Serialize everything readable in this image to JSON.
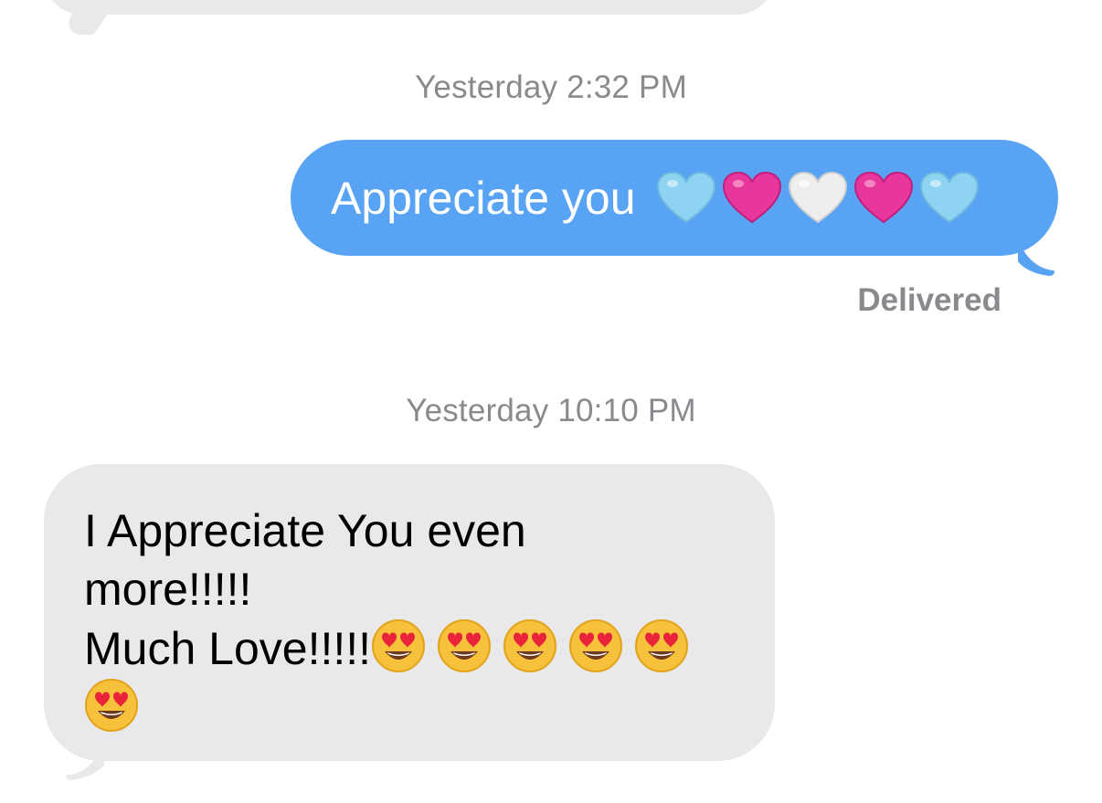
{
  "conversation": {
    "messages": [
      {
        "timestamp": "Yesterday 2:32 PM",
        "direction": "outgoing",
        "text": "Appreciate you",
        "emojis": [
          "light-blue-heart",
          "pink-heart",
          "white-heart",
          "pink-heart",
          "light-blue-heart"
        ],
        "status": "Delivered"
      },
      {
        "timestamp": "Yesterday 10:10 PM",
        "direction": "incoming",
        "line1": "I Appreciate You even",
        "line2": "more!!!!!",
        "line3": "Much Love!!!!!",
        "emoji_count": 6,
        "emoji": "heart-eyes-face"
      }
    ]
  },
  "colors": {
    "outgoing_bubble": "#58a3f3",
    "incoming_bubble": "#e9e9eb",
    "timestamp_text": "#8a8a8e",
    "light_blue_heart": "#8fd3f2",
    "pink_heart": "#e8369c",
    "white_heart": "#eeeeee"
  }
}
